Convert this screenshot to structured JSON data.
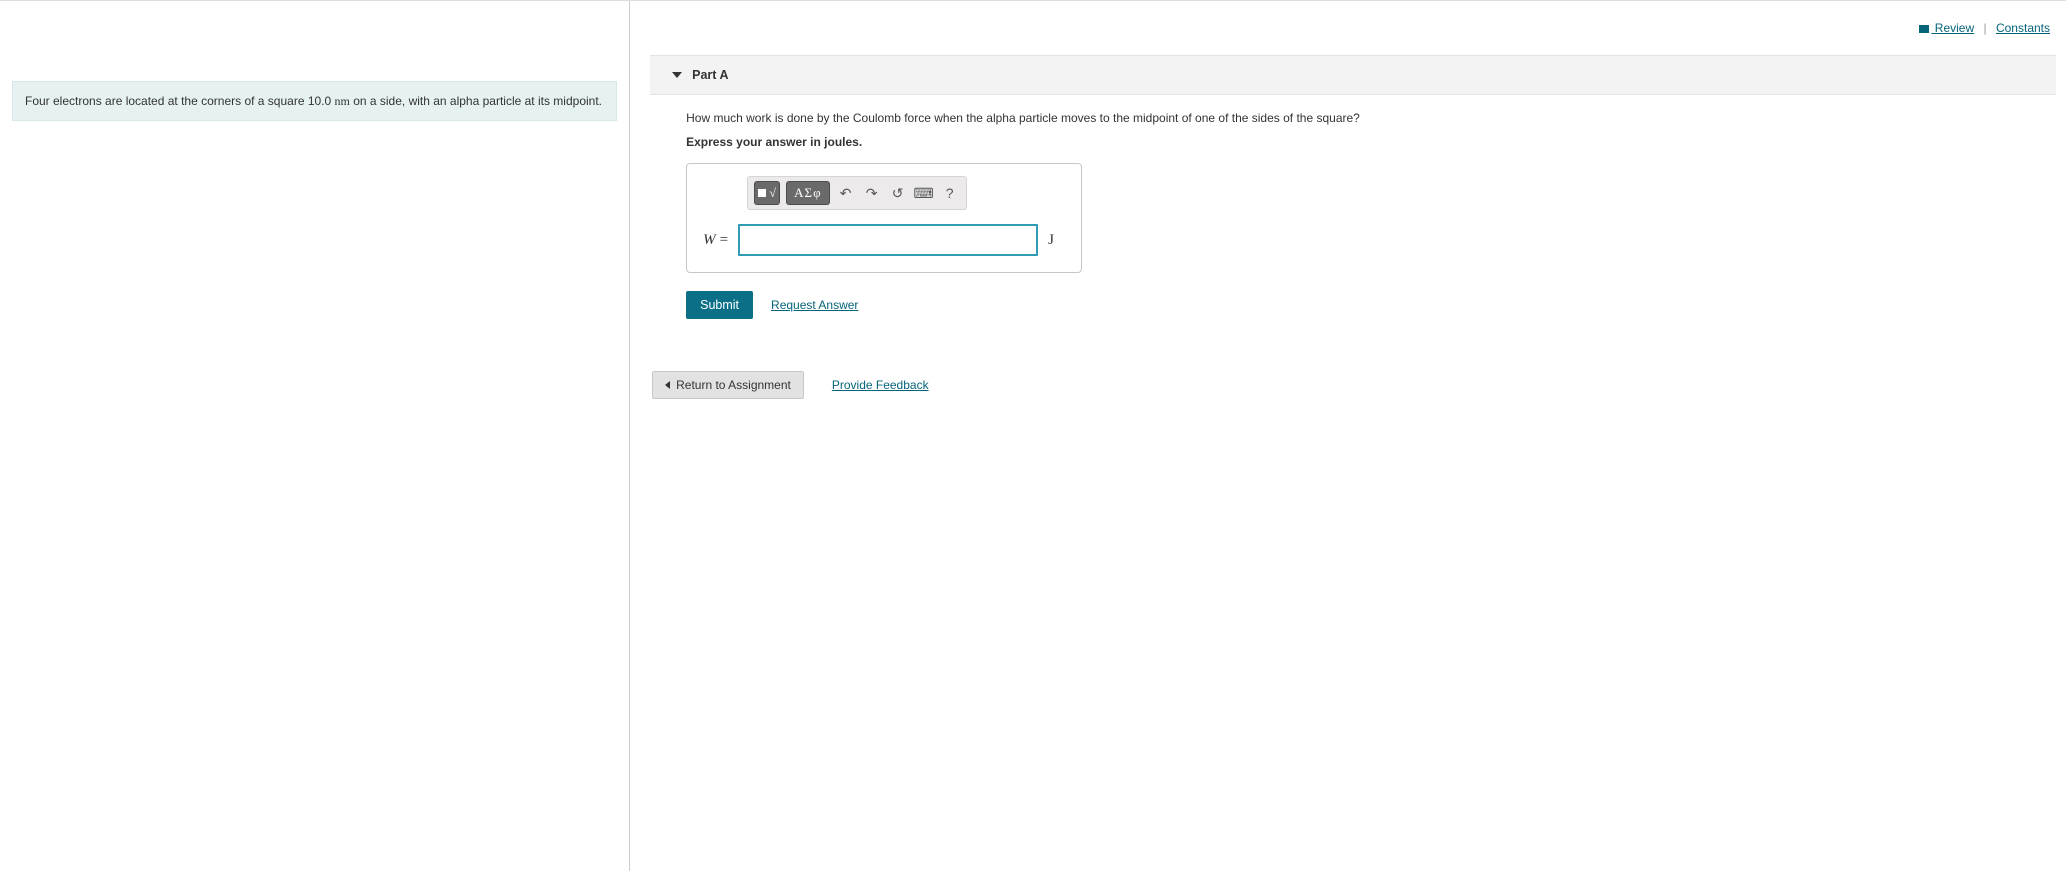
{
  "top_links": {
    "review": "Review",
    "constants": "Constants"
  },
  "problem": {
    "text_before": "Four electrons are located at the corners of a square 10.0 ",
    "unit_nm": "nm",
    "text_after": " on a side, with an alpha particle at its midpoint."
  },
  "part": {
    "label": "Part A",
    "question": "How much work is done by the Coulomb force when the alpha particle moves to the midpoint of one of the sides of the square?",
    "instruction": "Express your answer in joules.",
    "var_symbol": "W",
    "equals": "=",
    "unit": "J",
    "input_value": ""
  },
  "toolbar": {
    "template_label": "",
    "radical_label": "ⁿ√x",
    "greek_label": "ΑΣφ",
    "undo_title": "undo",
    "redo_title": "redo",
    "reset_title": "reset",
    "keyboard_title": "keyboard",
    "help_title": "help"
  },
  "actions": {
    "submit": "Submit",
    "request_answer": "Request Answer"
  },
  "footer": {
    "return_label": "Return to Assignment",
    "feedback": "Provide Feedback"
  }
}
